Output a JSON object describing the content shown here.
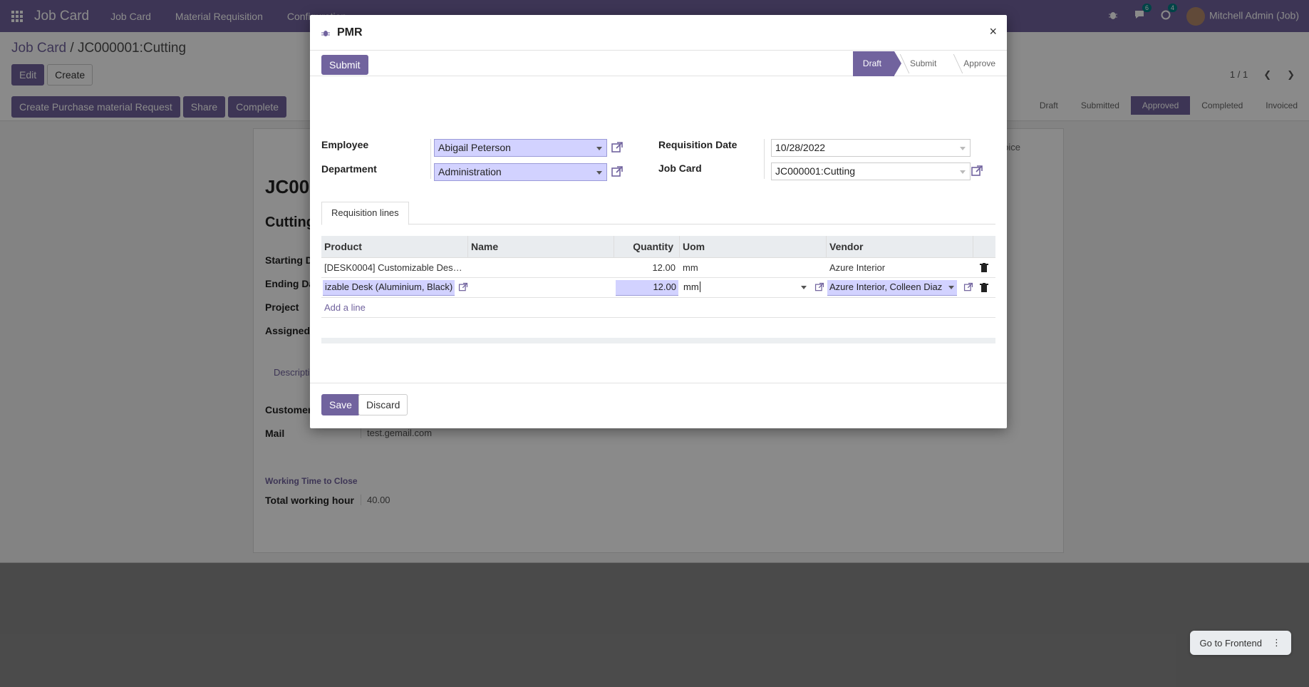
{
  "navbar": {
    "brand": "Job Card",
    "menus": [
      "Job Card",
      "Material Requisition",
      "Configuration"
    ],
    "messages_count": "6",
    "activities_count": "4",
    "user": "Mitchell Admin (Job)"
  },
  "control": {
    "breadcrumb_parent": "Job Card",
    "breadcrumb_sep": "/",
    "breadcrumb_current": "JC000001:Cutting",
    "edit_label": "Edit",
    "create_label": "Create",
    "pager": "1 / 1",
    "actions": [
      "Create Purchase material Request",
      "Share",
      "Complete"
    ],
    "stages": [
      "Draft",
      "Submitted",
      "Approved",
      "Completed",
      "Invoiced"
    ],
    "active_stage": "Approved"
  },
  "sheet": {
    "code": "JC00",
    "name": "Cutting",
    "labels": [
      "Starting Da",
      "Ending Da",
      "Project",
      "Assigned T"
    ],
    "tab": "Descripti",
    "customer_label": "Customer",
    "mail_label": "Mail",
    "mail_value": "test.gemail.com",
    "invoice_fragment": "voice",
    "section": "Working Time to Close",
    "hours_label": "Total working hour",
    "hours_value": "40.00"
  },
  "go_frontend": "Go to Frontend",
  "modal": {
    "title": "PMR",
    "submit_label": "Submit",
    "stages": [
      "Draft",
      "Submit",
      "Approve"
    ],
    "active_stage": "Draft",
    "employee_label": "Employee",
    "employee_value": "Abigail Peterson",
    "department_label": "Department",
    "department_value": "Administration",
    "req_date_label": "Requisition Date",
    "req_date_value": "10/28/2022",
    "job_card_label": "Job Card",
    "job_card_value": "JC000001:Cutting",
    "tab_label": "Requisition lines",
    "table": {
      "columns": [
        "Product",
        "Name",
        "Quantity",
        "Uom",
        "Vendor"
      ],
      "rows": [
        {
          "product": "[DESK0004] Customizable Des…",
          "name": "",
          "quantity": "12.00",
          "uom": "mm",
          "vendor": "Azure Interior"
        }
      ],
      "edit_row": {
        "product": "izable Desk (Aluminium, Black)",
        "quantity": "12.00",
        "uom": "mm",
        "vendor": "Azure Interior, Colleen Diaz"
      },
      "add_line": "Add a line"
    },
    "save_label": "Save",
    "discard_label": "Discard",
    "close_glyph": "×"
  },
  "colors": {
    "brand": "#71639e",
    "required": "#d2d2ff"
  }
}
